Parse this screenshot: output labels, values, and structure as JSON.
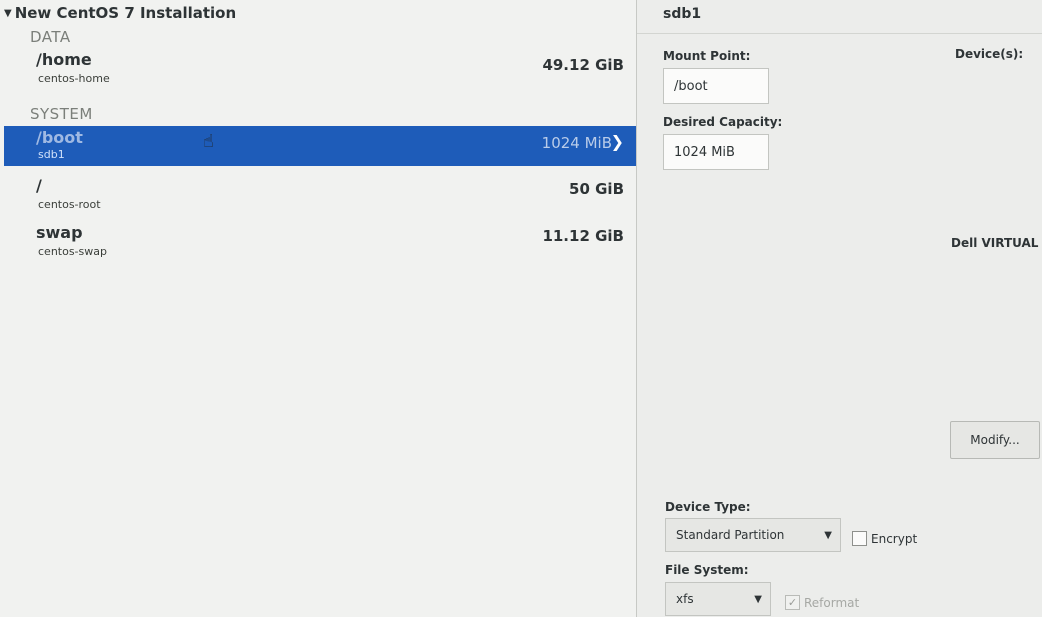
{
  "left": {
    "group_title": "New CentOS 7 Installation",
    "sections": [
      {
        "label": "DATA"
      },
      {
        "label": "SYSTEM"
      }
    ],
    "rows": [
      {
        "mount": "/home",
        "device": "centos-home",
        "size": "49.12 GiB"
      },
      {
        "mount": "/boot",
        "device": "sdb1",
        "size": "1024 MiB",
        "selected": true
      },
      {
        "mount": "/",
        "device": "centos-root",
        "size": "50 GiB"
      },
      {
        "mount": "swap",
        "device": "centos-swap",
        "size": "11.12 GiB"
      }
    ]
  },
  "right": {
    "title": "sdb1",
    "mount_point_label": "Mount Point:",
    "mount_point_value": "/boot",
    "desired_capacity_label": "Desired Capacity:",
    "desired_capacity_value": "1024 MiB",
    "devices_label": "Device(s):",
    "device_value": "Dell VIRTUAL I",
    "modify_label": "Modify...",
    "device_type_label": "Device Type:",
    "device_type_value": "Standard Partition",
    "encrypt_label": "Encrypt",
    "encrypt_checked": false,
    "file_system_label": "File System:",
    "file_system_value": "xfs",
    "reformat_label": "Reformat",
    "reformat_checked": true
  },
  "colors": {
    "selection": "#1e5cb9",
    "panel_bg": "#f1f2f0"
  }
}
